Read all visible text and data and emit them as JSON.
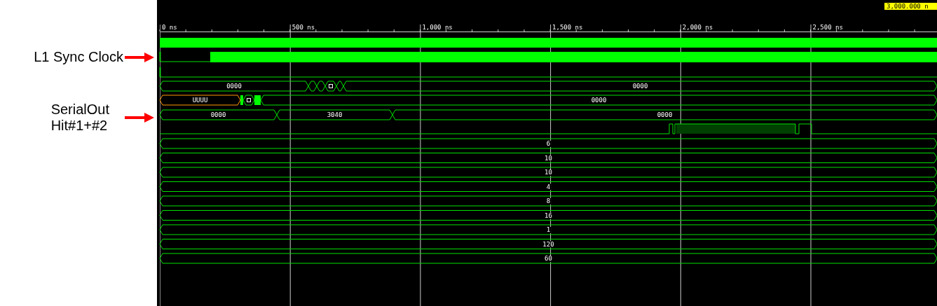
{
  "annotations": [
    {
      "lines": [
        "L1 Sync Clock"
      ]
    },
    {
      "lines": [
        "SerialOut",
        "Hit#1+#2"
      ]
    }
  ],
  "cursor_label": "3,000.000 n",
  "ruler": [
    "0 ns",
    "500 ns",
    "1,000 ns",
    "1,500 ns",
    "2,000 ns",
    "2,500 ns"
  ],
  "signals": [
    {
      "kind": "clock"
    },
    {
      "kind": "digital"
    },
    {
      "kind": "digital"
    },
    {
      "kind": "bus",
      "values": [
        {
          "value": "0000",
          "unknown": false
        },
        {
          "value": "0000",
          "unknown": false
        }
      ]
    },
    {
      "kind": "bus",
      "values": [
        {
          "value": "UUUU",
          "unknown": true
        },
        {
          "value": "0000",
          "unknown": false
        }
      ]
    },
    {
      "kind": "bus",
      "values": [
        {
          "value": "0000",
          "unknown": false
        },
        {
          "value": "3040",
          "unknown": false
        },
        {
          "value": "0000",
          "unknown": false
        }
      ]
    },
    {
      "kind": "digital"
    },
    {
      "kind": "bus",
      "values": [
        {
          "value": "6",
          "unknown": false
        }
      ]
    },
    {
      "kind": "bus",
      "values": [
        {
          "value": "10",
          "unknown": false
        }
      ]
    },
    {
      "kind": "bus",
      "values": [
        {
          "value": "10",
          "unknown": false
        }
      ]
    },
    {
      "kind": "bus",
      "values": [
        {
          "value": "4",
          "unknown": false
        }
      ]
    },
    {
      "kind": "bus",
      "values": [
        {
          "value": "8",
          "unknown": false
        }
      ]
    },
    {
      "kind": "bus",
      "values": [
        {
          "value": "16",
          "unknown": false
        }
      ]
    },
    {
      "kind": "bus",
      "values": [
        {
          "value": "1",
          "unknown": false
        }
      ]
    },
    {
      "kind": "bus",
      "values": [
        {
          "value": "120",
          "unknown": false
        }
      ]
    },
    {
      "kind": "bus",
      "values": [
        {
          "value": "60",
          "unknown": false
        }
      ]
    }
  ]
}
